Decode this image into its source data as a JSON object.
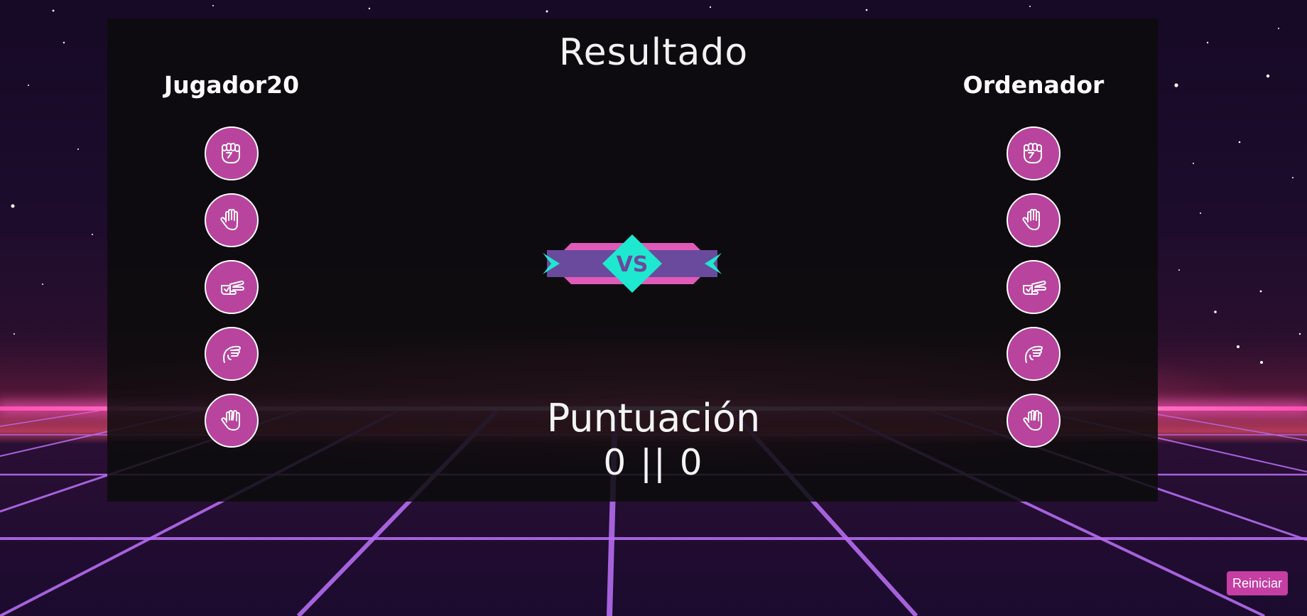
{
  "game": {
    "title": "Resultado",
    "player1": {
      "name": "Jugador20"
    },
    "player2": {
      "name": "Ordenador"
    },
    "choices": [
      {
        "icon": "fist-icon"
      },
      {
        "icon": "open-hand-icon"
      },
      {
        "icon": "scissors-hand-icon"
      },
      {
        "icon": "lizard-hand-icon"
      },
      {
        "icon": "spock-hand-icon"
      }
    ],
    "vs_label": "VS",
    "score": {
      "title": "Puntuación",
      "player1": "0",
      "separator": "||",
      "player2": "0"
    },
    "restart_label": "Reiniciar"
  },
  "colors": {
    "accent": "#b8449e",
    "vs_teal": "#1ee8cf",
    "vs_purple": "#6a4a9c",
    "vs_pink": "#e05ab8",
    "grid_line": "#b56cf0",
    "horizon": "#ff4fb3"
  }
}
